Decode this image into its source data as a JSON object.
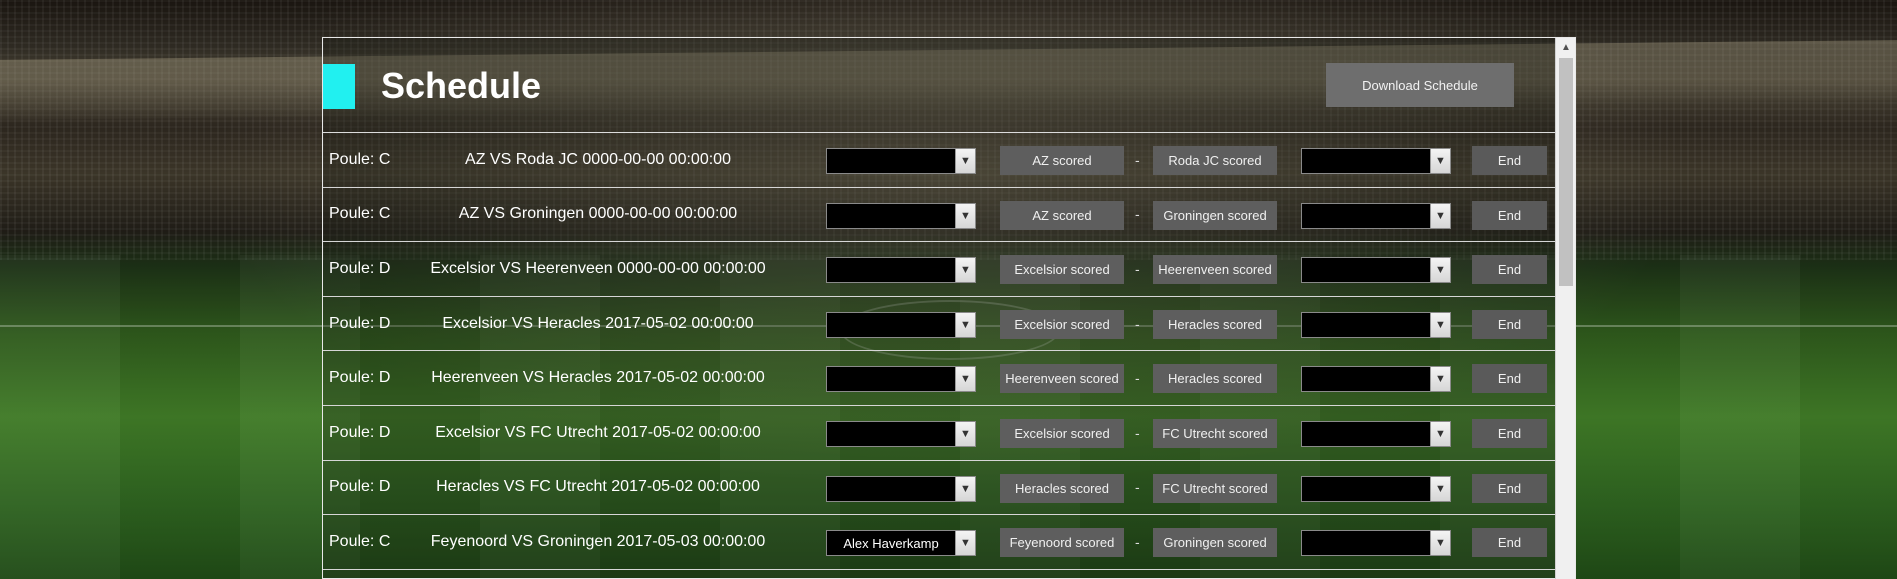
{
  "page": {
    "title": "Schedule",
    "download_label": "Download Schedule"
  },
  "colors": {
    "accent": "#21f0f0",
    "button": "#5e5e5e"
  },
  "rows": [
    {
      "poule": "Poule: C",
      "match": "AZ VS Roda JC 0000-00-00 00:00:00",
      "home_select": "",
      "home_btn": "AZ scored",
      "dash": "-",
      "away_btn": "Roda JC scored",
      "away_select": "",
      "end": "End"
    },
    {
      "poule": "Poule: C",
      "match": "AZ VS Groningen 0000-00-00 00:00:00",
      "home_select": "",
      "home_btn": "AZ scored",
      "dash": "-",
      "away_btn": "Groningen scored",
      "away_select": "",
      "end": "End"
    },
    {
      "poule": "Poule: D",
      "match": "Excelsior VS Heerenveen 0000-00-00 00:00:00",
      "home_select": "",
      "home_btn": "Excelsior scored",
      "dash": "-",
      "away_btn": "Heerenveen scored",
      "away_select": "",
      "end": "End"
    },
    {
      "poule": "Poule: D",
      "match": "Excelsior VS Heracles 2017-05-02 00:00:00",
      "home_select": "",
      "home_btn": "Excelsior scored",
      "dash": "-",
      "away_btn": "Heracles scored",
      "away_select": "",
      "end": "End"
    },
    {
      "poule": "Poule: D",
      "match": "Heerenveen VS Heracles 2017-05-02 00:00:00",
      "home_select": "",
      "home_btn": "Heerenveen scored",
      "dash": "-",
      "away_btn": "Heracles scored",
      "away_select": "",
      "end": "End"
    },
    {
      "poule": "Poule: D",
      "match": "Excelsior VS FC Utrecht 2017-05-02 00:00:00",
      "home_select": "",
      "home_btn": "Excelsior scored",
      "dash": "-",
      "away_btn": "FC Utrecht scored",
      "away_select": "",
      "end": "End"
    },
    {
      "poule": "Poule: D",
      "match": "Heracles VS FC Utrecht 2017-05-02 00:00:00",
      "home_select": "",
      "home_btn": "Heracles scored",
      "dash": "-",
      "away_btn": "FC Utrecht scored",
      "away_select": "",
      "end": "End"
    },
    {
      "poule": "Poule: C",
      "match": "Feyenoord VS Groningen 2017-05-03 00:00:00",
      "home_select": "Alex Haverkamp",
      "home_btn": "Feyenoord scored",
      "dash": "-",
      "away_btn": "Groningen scored",
      "away_select": "",
      "end": "End"
    }
  ],
  "icons": {
    "select_arrow": "chevron-down-icon",
    "scroll_up": "scroll-up-arrow-icon"
  }
}
